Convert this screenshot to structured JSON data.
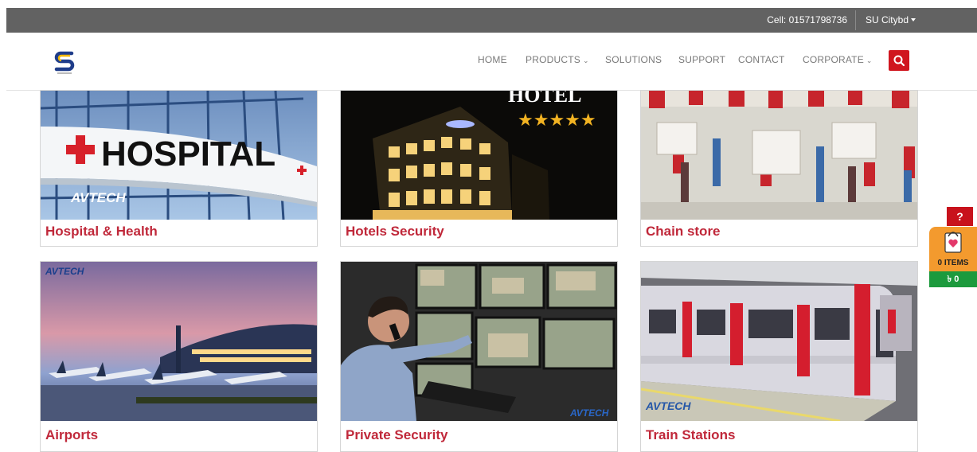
{
  "topbar": {
    "cell": "Cell: 01571798736",
    "user": "SU Citybd"
  },
  "nav": {
    "home": "HOME",
    "products": "PRODUCTS",
    "solutions": "SOLUTIONS",
    "support": "SUPPORT",
    "contact": "CONTACT",
    "corporate": "CORPORATE"
  },
  "cards": [
    {
      "title": "Hospital & Health",
      "sign": "HOSPITAL",
      "brand": "AVTECH"
    },
    {
      "title": "Hotels Security",
      "sign": "HOTEL",
      "stars": "★★★★★"
    },
    {
      "title": "Chain store"
    },
    {
      "title": "Airports",
      "brand": "AVTECH"
    },
    {
      "title": "Private Security",
      "brand": "AVTECH"
    },
    {
      "title": "Train Stations",
      "brand": "AVTECH"
    }
  ],
  "widgets": {
    "help": "?",
    "cart_items": "0 ITEMS",
    "cart_total": "৳ 0"
  },
  "colors": {
    "accent": "#d0161f",
    "title": "#c0283a",
    "topbar": "#626262",
    "cart": "#f39a2e",
    "total": "#1c9a3d"
  }
}
